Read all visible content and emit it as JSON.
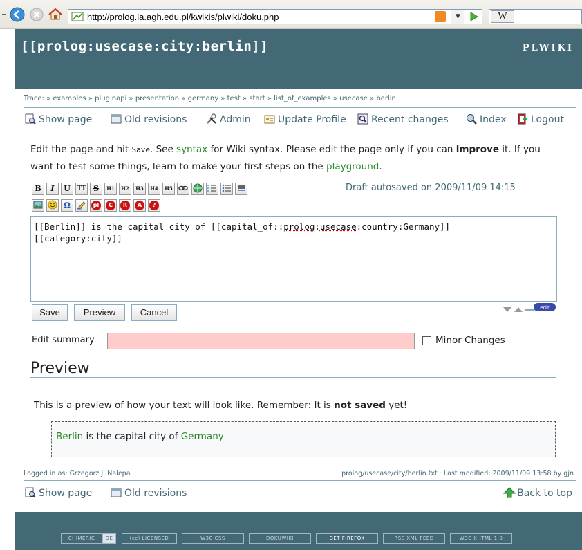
{
  "browser": {
    "url": "http://prolog.ia.agh.edu.pl/kwikis/plwiki/doku.php",
    "search_logo": "W"
  },
  "header": {
    "page_id": "[[prolog:usecase:city:berlin]]",
    "logo": "PLWIKI"
  },
  "trace": {
    "label": "Trace:",
    "items": [
      "examples",
      "pluginapi",
      "presentation",
      "germany",
      "test",
      "start",
      "list_of_examples",
      "usecase",
      "berlin"
    ]
  },
  "actions": {
    "show_page": "Show page",
    "old_revisions": "Old revisions",
    "admin": "Admin",
    "update_profile": "Update Profile",
    "recent_changes": "Recent changes",
    "index": "Index",
    "logout": "Logout"
  },
  "intro": {
    "part1": "Edit the page and hit ",
    "save_code": "Save",
    "part2": ". See ",
    "syntax_link": "syntax",
    "part3": " for Wiki syntax. Please edit the page only if you can ",
    "improve": "improve",
    "part4": " it. If you want to test some things, learn to make your first steps on the ",
    "playground_link": "playground",
    "part5": "."
  },
  "toolbar": {
    "row1": [
      {
        "name": "bold-button",
        "label": "B"
      },
      {
        "name": "italic-button",
        "label": "I"
      },
      {
        "name": "underline-button",
        "label": "U"
      },
      {
        "name": "code-button",
        "label": "TT"
      },
      {
        "name": "strike-button",
        "label": "S"
      },
      {
        "name": "h1-button",
        "label": "H1"
      },
      {
        "name": "h2-button",
        "label": "H2"
      },
      {
        "name": "h3-button",
        "label": "H3"
      },
      {
        "name": "h4-button",
        "label": "H4"
      },
      {
        "name": "h5-button",
        "label": "H5"
      }
    ],
    "row2_labels": {
      "omega": "Ω",
      "pl": "pl",
      "c": "C",
      "r": "R",
      "a": "A",
      "q": "?"
    },
    "draft": "Draft autosaved on 2009/11/09 14:15"
  },
  "editor": {
    "line1_a": "[[Berlin]] is the capital city of [[capital_of::",
    "line1_b": "prolog",
    "line1_c": ":",
    "line1_d": "usecase",
    "line1_e": ":country:Germany]]",
    "line2": "[[category:city]]",
    "edit_badge": "edit"
  },
  "buttons": {
    "save": "Save",
    "preview": "Preview",
    "cancel": "Cancel"
  },
  "summary": {
    "label": "Edit summary",
    "value": "",
    "minor_label": "Minor Changes"
  },
  "preview": {
    "heading": "Preview",
    "note_a": "This is a preview of how your text will look like. Remember: It is ",
    "note_b": "not saved",
    "note_c": " yet!",
    "link1": "Berlin",
    "text": " is the capital city of ",
    "link2": "Germany"
  },
  "footer": {
    "logged_in": "Logged in as: Grzegorz J. Nalepa",
    "last_modified": "prolog/usecase/city/berlin.txt · Last modified: 2009/11/09 13:58 by gjn",
    "show_page": "Show page",
    "old_revisions": "Old revisions",
    "back_to_top": "Back to top",
    "badges": {
      "chimeric": "CHIMERIC",
      "de": "DE",
      "cc": "(cc) LICENSED",
      "w3c_css": "W3C CSS",
      "dokuwiki": "DOKUWIKI",
      "firefox": "GET FIREFOX",
      "rss": "RSS XML FEED",
      "w3c_xhtml": "W3C XHTML 1.0"
    }
  },
  "colors": {
    "brand": "#436976",
    "link": "#2b8a2b",
    "summary_bg": "#ffcccc"
  }
}
